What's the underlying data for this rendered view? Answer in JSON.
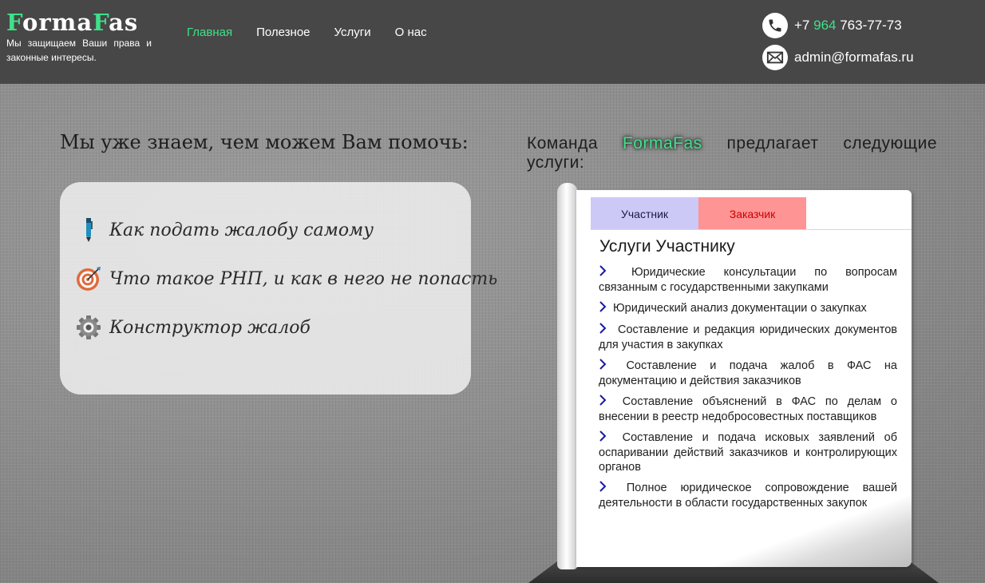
{
  "header": {
    "logo": {
      "part1": "F",
      "part2": "orma",
      "part3": "F",
      "part4": "as",
      "tagline": "Мы защищаем Ваши права и законные интересы."
    },
    "nav": [
      {
        "label": "Главная",
        "active": true
      },
      {
        "label": "Полезное"
      },
      {
        "label": "Услуги"
      },
      {
        "label": "О нас"
      }
    ],
    "phone": {
      "prefix": "+7 ",
      "code": "964",
      "number": " 763-77-73"
    },
    "email": "admin@formafas.ru"
  },
  "left": {
    "title": "Мы уже знаем, чем можем Вам помочь:",
    "items": [
      {
        "label": "Как подать жалобу самому",
        "icon": "pen-icon"
      },
      {
        "label": "Что такое РНП, и как в него не попасть",
        "icon": "target-icon"
      },
      {
        "label": "Конструктор жалоб",
        "icon": "gear-icon"
      }
    ]
  },
  "right": {
    "title_before": "Команда ",
    "brand": "FormaFas",
    "title_after": " предлагает следующие услуги:",
    "tabs": [
      {
        "label": "Участник"
      },
      {
        "label": "Заказчик"
      }
    ],
    "heading": "Услуги Участнику",
    "services": [
      "Юридические консультации по вопросам связанным с государственными закупками",
      "Юридический анализ документации о закупках",
      "Составление и редакция юридических документов для участия в закупках",
      "Составление и подача жалоб в ФАС на документацию и действия заказчиков",
      "Составление объяснений в ФАС по делам о внесении в реестр недобросовестных поставщиков",
      "Составление и подача исковых заявлений об оспаривании действий заказчиков и контролирующих органов",
      "Полное юридическое сопровождение вашей деятельности в области государственных закупок"
    ]
  },
  "colors": {
    "accent": "#3fe08a",
    "header_bg": "#474747",
    "tab_participant": "#cdc9f7",
    "tab_customer": "#ff9494"
  }
}
